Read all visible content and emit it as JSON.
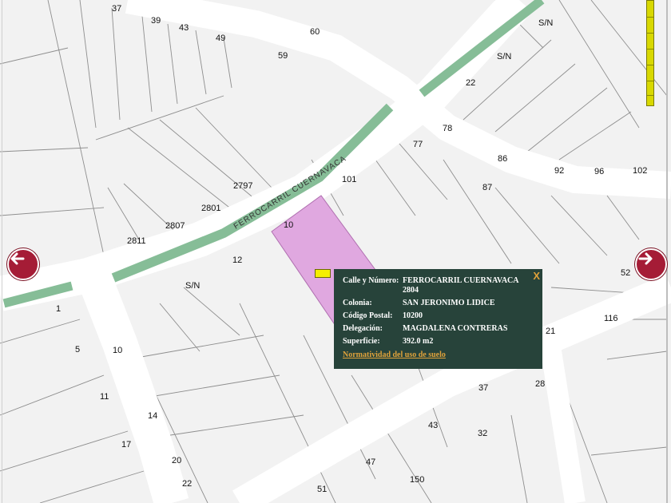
{
  "map": {
    "street_name": "FERROCARRIL CUERNAVACA",
    "lot_numbers": [
      "37",
      "39",
      "43",
      "49",
      "60",
      "59",
      "S/N",
      "S/N",
      "22",
      "78",
      "77",
      "86",
      "92",
      "96",
      "102",
      "101",
      "87",
      "2797",
      "2801",
      "2807",
      "2811",
      "10",
      "12",
      "S/N",
      "1",
      "5",
      "10",
      "11",
      "14",
      "17",
      "20",
      "22",
      "52",
      "116",
      "21",
      "37",
      "28",
      "43",
      "32",
      "47",
      "150",
      "51"
    ],
    "colors": {
      "road": "#ffffff",
      "rail_strip": "#86bd97",
      "highlight": "#e0a8e0",
      "popup_bg": "#27433a",
      "nav": "#a51c36",
      "link": "#e0a23a"
    }
  },
  "nav": {
    "left_icon": "arrow-left-icon",
    "right_icon": "arrow-right-icon"
  },
  "popup": {
    "close": "X",
    "rows": [
      {
        "label": "Calle y Número:",
        "value": "FERROCARRIL CUERNAVACA 2804"
      },
      {
        "label": "Colonia:",
        "value": "SAN JERONIMO LIDICE"
      },
      {
        "label": "Código Postal:",
        "value": "10200"
      },
      {
        "label": "Delegación:",
        "value": "MAGDALENA CONTRERAS"
      },
      {
        "label": "Superficie:",
        "value": "392.0 m2"
      }
    ],
    "link": "Normatividad del uso de suelo"
  }
}
